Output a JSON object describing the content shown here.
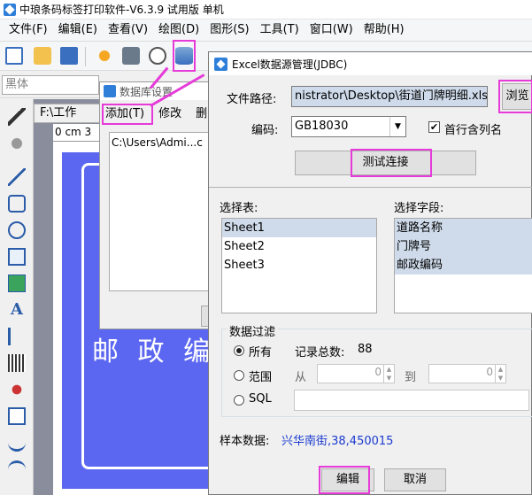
{
  "app": {
    "title": "中琅条码标签打印软件-V6.3.9 试用版 单机"
  },
  "menubar": {
    "items": [
      "文件(F)",
      "编辑(E)",
      "查看(V)",
      "绘图(D)",
      "图形(S)",
      "工具(T)",
      "窗口(W)",
      "帮助(H)"
    ]
  },
  "fontrow": {
    "font_name": "黑体"
  },
  "doc": {
    "tab_label": "F:\\工作",
    "ruler_label": "0 cm 3",
    "label_text": "邮 政 编 码"
  },
  "db_dialog": {
    "title": "数据库设置",
    "add_label": "添加(T)",
    "modify_label": "修改",
    "delete_label": "删",
    "list_item": "C:\\Users\\Admi...c"
  },
  "dialog": {
    "title": "Excel数据源管理(JDBC)",
    "file_path_label": "文件路径:",
    "file_path_value": "nistrator\\Desktop\\街道门牌明细.xls",
    "browse_label": "浏览",
    "encoding_label": "编码:",
    "encoding_value": "GB18030",
    "header_row_label": "首行含列名",
    "test_connection_label": "测试连接",
    "select_table_label": "选择表:",
    "tables": [
      "Sheet1",
      "Sheet2",
      "Sheet3"
    ],
    "select_field_label": "选择字段:",
    "fields": [
      "道路名称",
      "门牌号",
      "邮政编码"
    ],
    "filter_group_label": "数据过滤",
    "filter_all_label": "所有",
    "record_count_label": "记录总数:",
    "record_count_value": "88",
    "filter_range_label": "范围",
    "from_label": "从",
    "to_label": "到",
    "spin_from_value": "0",
    "spin_to_value": "0",
    "filter_sql_label": "SQL",
    "sample_label": "样本数据:",
    "sample_value": "兴华南街,38,450015",
    "edit_label": "编辑",
    "cancel_label": "取消"
  },
  "colors": {
    "highlight": "#e63ad9",
    "label_blue": "#5b67f0",
    "sample_text": "#1a3bcf",
    "selection": "#cfdbea"
  }
}
